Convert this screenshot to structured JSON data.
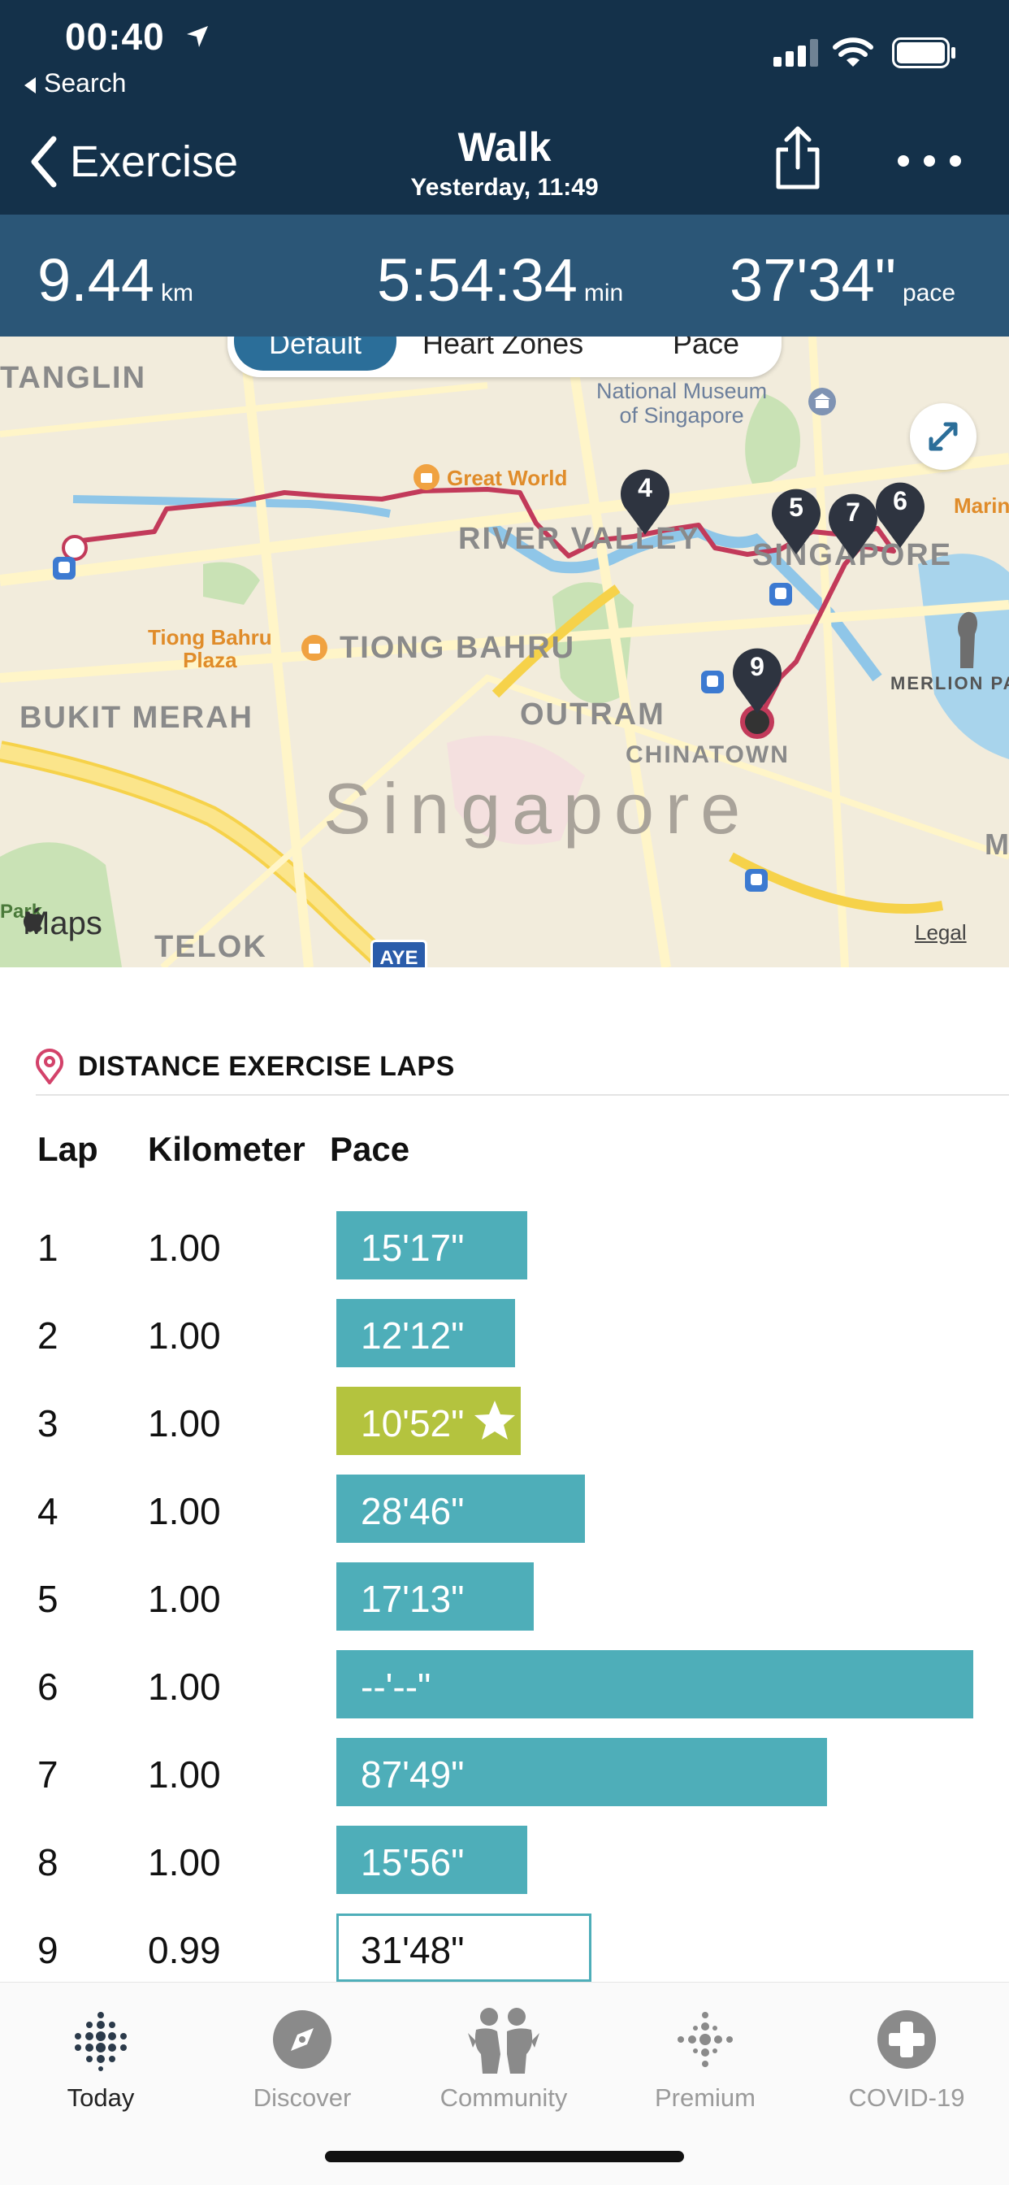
{
  "status_bar": {
    "time": "00:40",
    "back_app": "Search"
  },
  "nav": {
    "back_label": "Exercise",
    "title": "Walk",
    "subtitle": "Yesterday, 11:49"
  },
  "stats": {
    "distance": {
      "value": "9.44",
      "unit": "km"
    },
    "duration": {
      "value": "5:54:34",
      "unit": "min"
    },
    "pace": {
      "value": "37'34\"",
      "unit": "pace"
    }
  },
  "map": {
    "segments": [
      "Default",
      "Heart Zones",
      "Pace"
    ],
    "labels": {
      "tanglin": "TANGLIN",
      "museum": "National Museum\nof Singapore",
      "great_world": "Great World",
      "river_valley": "RIVER VALLEY",
      "singapore_area": "SINGAPORE",
      "marina": "Marin",
      "tiong_bahru_plaza": "Tiong Bahru\nPlaza",
      "tiong_bahru": "TIONG BAHRU",
      "bukit_merah": "BUKIT MERAH",
      "outram": "OUTRAM",
      "chinatown": "CHINATOWN",
      "merlion": "MERLION PA",
      "city": "Singapore",
      "telok": "TELOK",
      "park": "Park",
      "m_edge": "M",
      "aye": "AYE",
      "maps_brand": "Maps",
      "legal": "Legal"
    },
    "markers": [
      "4",
      "5",
      "7",
      "6",
      "9"
    ],
    "accent_route": "#c23a5a"
  },
  "laps": {
    "section_title": "DISTANCE EXERCISE LAPS",
    "columns": [
      "Lap",
      "Kilometer",
      "Pace"
    ],
    "rows": [
      {
        "lap": "1",
        "km": "1.00",
        "pace": "15'17\"",
        "fraction": 0.3,
        "best": false,
        "partial": false
      },
      {
        "lap": "2",
        "km": "1.00",
        "pace": "12'12\"",
        "fraction": 0.28,
        "best": false,
        "partial": false
      },
      {
        "lap": "3",
        "km": "1.00",
        "pace": "10'52\"",
        "fraction": 0.29,
        "best": true,
        "partial": false
      },
      {
        "lap": "4",
        "km": "1.00",
        "pace": "28'46\"",
        "fraction": 0.39,
        "best": false,
        "partial": false
      },
      {
        "lap": "5",
        "km": "1.00",
        "pace": "17'13\"",
        "fraction": 0.31,
        "best": false,
        "partial": false
      },
      {
        "lap": "6",
        "km": "1.00",
        "pace": "--'--\"",
        "fraction": 1.0,
        "best": false,
        "partial": false
      },
      {
        "lap": "7",
        "km": "1.00",
        "pace": "87'49\"",
        "fraction": 0.77,
        "best": false,
        "partial": false
      },
      {
        "lap": "8",
        "km": "1.00",
        "pace": "15'56\"",
        "fraction": 0.3,
        "best": false,
        "partial": false
      },
      {
        "lap": "9",
        "km": "0.99",
        "pace": "31'48\"",
        "fraction": 0.4,
        "best": false,
        "partial": true
      }
    ],
    "colors": {
      "bar": "#4eaeb9",
      "best": "#b4c33e"
    }
  },
  "tabs": [
    {
      "label": "Today",
      "icon": "today-dots-icon",
      "active": true
    },
    {
      "label": "Discover",
      "icon": "compass-icon",
      "active": false
    },
    {
      "label": "Community",
      "icon": "community-people-icon",
      "active": false
    },
    {
      "label": "Premium",
      "icon": "premium-dots-icon",
      "active": false
    },
    {
      "label": "COVID-19",
      "icon": "medical-cross-icon",
      "active": false
    }
  ]
}
